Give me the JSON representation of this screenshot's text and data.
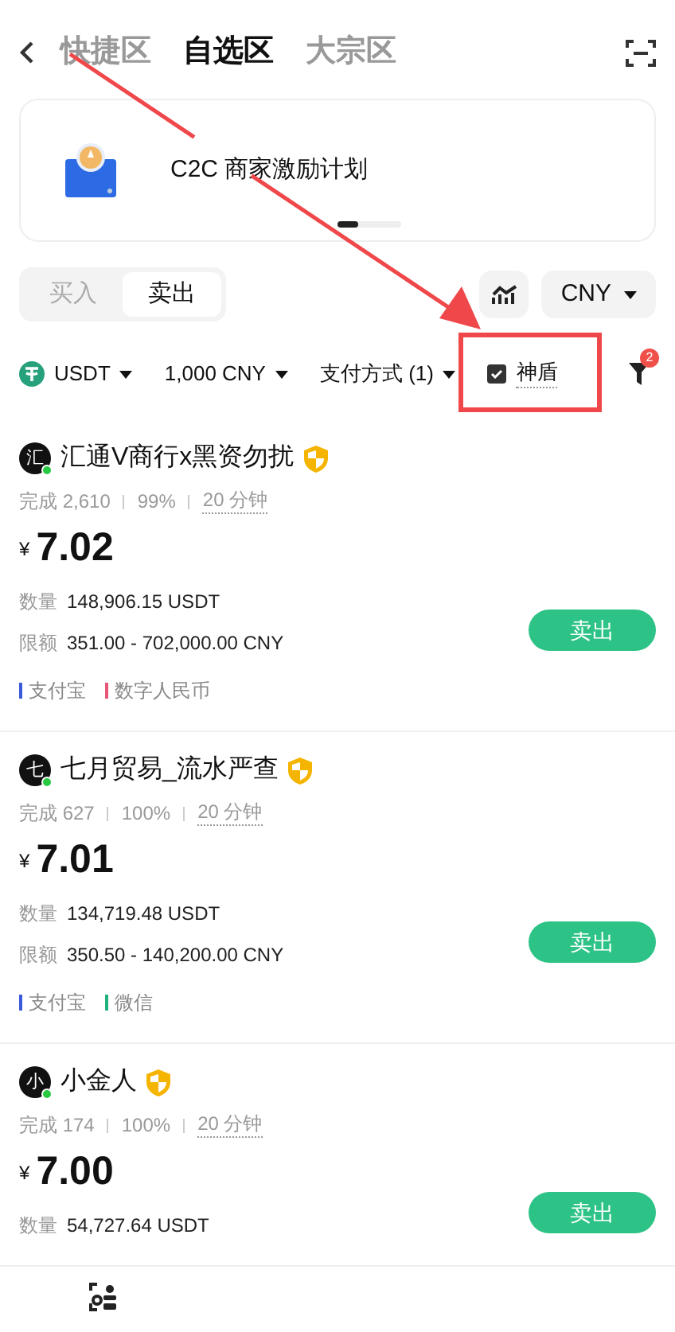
{
  "header": {
    "tabs": [
      {
        "label": "快捷区",
        "selected": false
      },
      {
        "label": "自选区",
        "selected": true
      },
      {
        "label": "大宗区",
        "selected": false
      }
    ]
  },
  "banner": {
    "title": "C2C 商家激励计划"
  },
  "side_toggle": [
    {
      "label": "买入",
      "selected": false
    },
    {
      "label": "卖出",
      "selected": true
    }
  ],
  "currency": "CNY",
  "filters": {
    "coin": "USDT",
    "amount": "1,000 CNY",
    "payment": "支付方式 (1)",
    "shield": {
      "label": "神盾",
      "checked": true
    },
    "filter_count": "2"
  },
  "ads": [
    {
      "avatar": "汇",
      "online": true,
      "name": "汇通V商行x黑资勿扰",
      "completed": "完成 2,610",
      "rate": "99%",
      "time": "20 分钟",
      "currency_symbol": "¥",
      "price": "7.02",
      "quantity_label": "数量",
      "quantity": "148,906.15 USDT",
      "limit_label": "限额",
      "limit": "351.00 - 702,000.00 CNY",
      "payments": [
        {
          "name": "支付宝",
          "color": "#3b5bdb"
        },
        {
          "name": "数字人民币",
          "color": "#e8577a"
        }
      ],
      "action": "卖出"
    },
    {
      "avatar": "七",
      "online": true,
      "name": "七月贸易_流水严查",
      "completed": "完成 627",
      "rate": "100%",
      "time": "20 分钟",
      "currency_symbol": "¥",
      "price": "7.01",
      "quantity_label": "数量",
      "quantity": "134,719.48 USDT",
      "limit_label": "限额",
      "limit": "350.50 - 140,200.00 CNY",
      "payments": [
        {
          "name": "支付宝",
          "color": "#3b5bdb"
        },
        {
          "name": "微信",
          "color": "#20b27a"
        }
      ],
      "action": "卖出"
    },
    {
      "avatar": "小",
      "online": true,
      "name": "小金人",
      "completed": "完成 174",
      "rate": "100%",
      "time": "20 分钟",
      "currency_symbol": "¥",
      "price": "7.00",
      "quantity_label": "数量",
      "quantity": "54,727.64 USDT",
      "action": "卖出"
    }
  ]
}
